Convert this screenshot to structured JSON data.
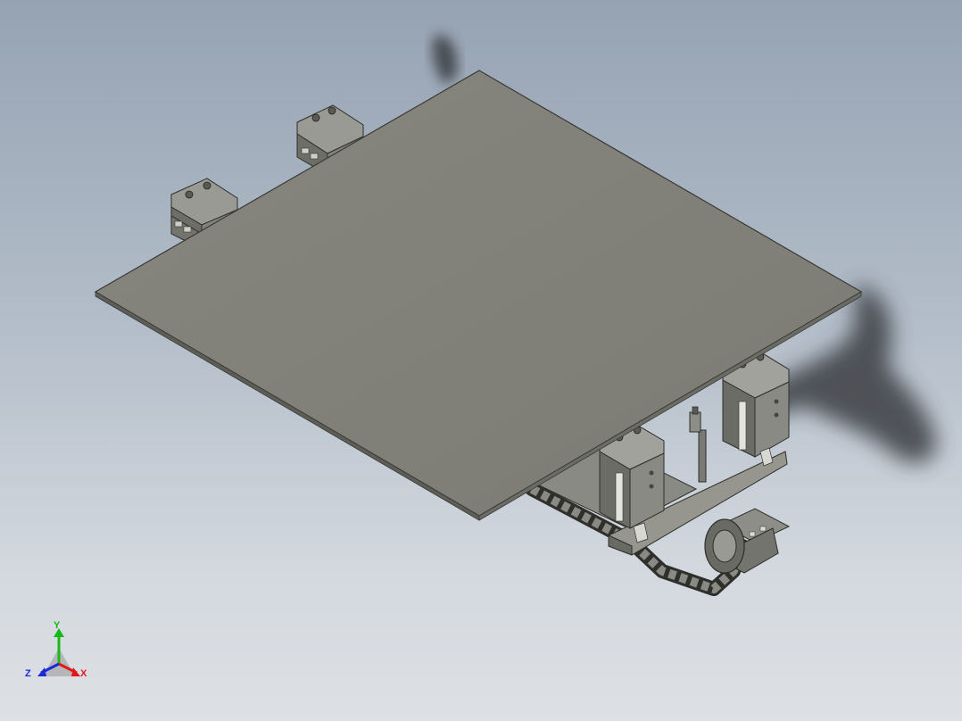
{
  "viewport": {
    "background_top": "#96a3b3",
    "background_bottom": "#dde0e4"
  },
  "model": {
    "plate_color": "#828279",
    "edge_color": "#3a3a36",
    "part_color": "#8e8e88",
    "shadow_color": "#3a3d42"
  },
  "triad": {
    "x_label": "X",
    "y_label": "Y",
    "z_label": "Z",
    "x_color": "#e01818",
    "y_color": "#18b818",
    "z_color": "#1a2ad8"
  }
}
